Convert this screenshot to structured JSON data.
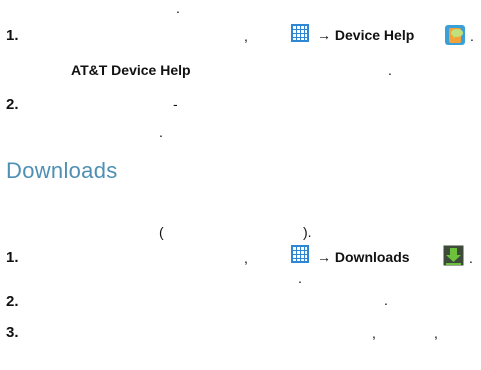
{
  "top": {
    "dot": "."
  },
  "help_steps": [
    {
      "num": "1.",
      "comma": ",",
      "arrow_text": "→ Device Help",
      "trailing": ".",
      "subline_bold": "AT&T Device Help",
      "subline_dot": "."
    },
    {
      "num": "2.",
      "dash": "-",
      "dot": "."
    }
  ],
  "downloads": {
    "title": "Downloads",
    "paren_open": "(",
    "paren_close": ").",
    "steps": [
      {
        "num": "1.",
        "comma": ",",
        "arrow_text": "→ Downloads",
        "trailing": ".",
        "subline_dot": "."
      },
      {
        "num": "2.",
        "dot": "."
      },
      {
        "num": "3.",
        "comma1": ",",
        "comma2": ","
      }
    ]
  },
  "icons": [
    "apps-grid-icon",
    "device-help-icon",
    "apps-grid-icon",
    "downloads-icon"
  ],
  "colors": {
    "heading": "#4f8fb4",
    "icon_blue": "#2f86d4",
    "download_green": "#4caf2a"
  }
}
